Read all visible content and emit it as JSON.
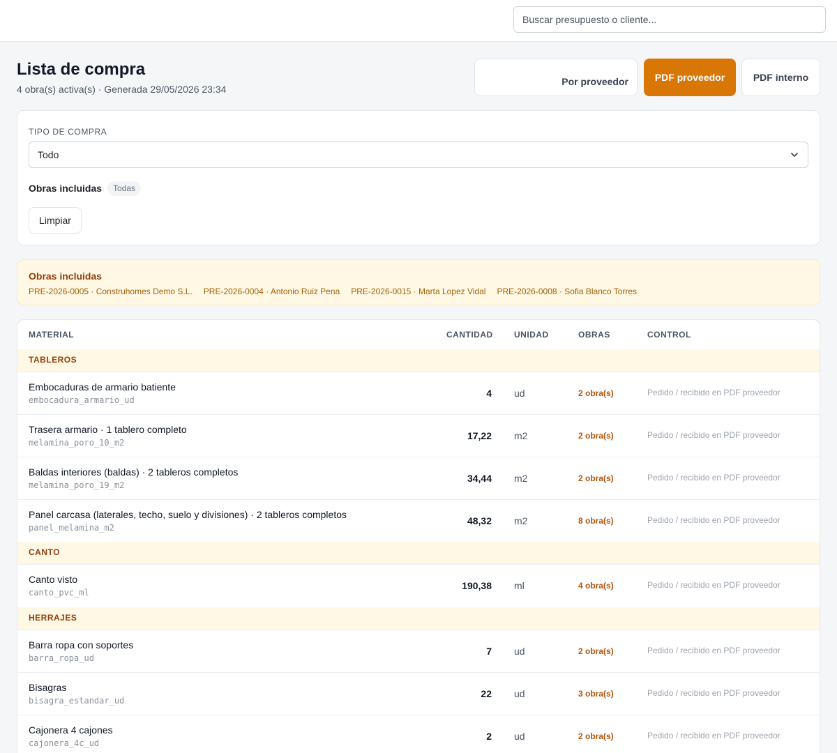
{
  "search": {
    "placeholder": "Buscar presupuesto o cliente..."
  },
  "header": {
    "title": "Lista de compra",
    "subtitle": "4 obra(s) activa(s) · Generada 29/05/2026 23:34",
    "btn_por_proveedor": "Por proveedor",
    "btn_pdf_proveedor": "PDF proveedor",
    "btn_pdf_interno": "PDF interno"
  },
  "filters": {
    "tipo_label": "TIPO DE COMPRA",
    "tipo_value": "Todo",
    "obras_label": "Obras incluidas",
    "obras_pill": "Todas",
    "clear_label": "Limpiar"
  },
  "banner": {
    "title": "Obras incluidas",
    "items": [
      "PRE-2026-0005 · Construhomes Demo S.L.",
      "PRE-2026-0004 · Antonio Ruiz Pena",
      "PRE-2026-0015 · Marta Lopez Vidal",
      "PRE-2026-0008 · Sofia Blanco Torres"
    ]
  },
  "table": {
    "columns": {
      "material": "MATERIAL",
      "cantidad": "CANTIDAD",
      "unidad": "UNIDAD",
      "obras": "OBRAS",
      "control": "CONTROL"
    },
    "control_text": "Pedido / recibido en PDF proveedor",
    "categories": [
      {
        "name": "TABLEROS",
        "rows": [
          {
            "name": "Embocaduras de armario batiente",
            "code": "embocadura_armario_ud",
            "qty": "4",
            "unit": "ud",
            "obras": "2 obra(s)"
          },
          {
            "name": "Trasera armario · 1 tablero completo",
            "code": "melamina_poro_10_m2",
            "qty": "17,22",
            "unit": "m2",
            "obras": "2 obra(s)"
          },
          {
            "name": "Baldas interiores (baldas) · 2 tableros completos",
            "code": "melamina_poro_19_m2",
            "qty": "34,44",
            "unit": "m2",
            "obras": "2 obra(s)"
          },
          {
            "name": "Panel carcasa (laterales, techo, suelo y divisiones) · 2 tableros completos",
            "code": "panel_melamina_m2",
            "qty": "48,32",
            "unit": "m2",
            "obras": "8 obra(s)"
          }
        ]
      },
      {
        "name": "CANTO",
        "rows": [
          {
            "name": "Canto visto",
            "code": "canto_pvc_ml",
            "qty": "190,38",
            "unit": "ml",
            "obras": "4 obra(s)"
          }
        ]
      },
      {
        "name": "HERRAJES",
        "rows": [
          {
            "name": "Barra ropa con soportes",
            "code": "barra_ropa_ud",
            "qty": "7",
            "unit": "ud",
            "obras": "2 obra(s)"
          },
          {
            "name": "Bisagras",
            "code": "bisagra_estandar_ud",
            "qty": "22",
            "unit": "ud",
            "obras": "3 obra(s)"
          },
          {
            "name": "Cajonera 4 cajones",
            "code": "cajonera_4c_ud",
            "qty": "2",
            "unit": "ud",
            "obras": "2 obra(s)"
          }
        ]
      }
    ]
  },
  "icons": {
    "select_chevron": "chevron-down-icon"
  }
}
